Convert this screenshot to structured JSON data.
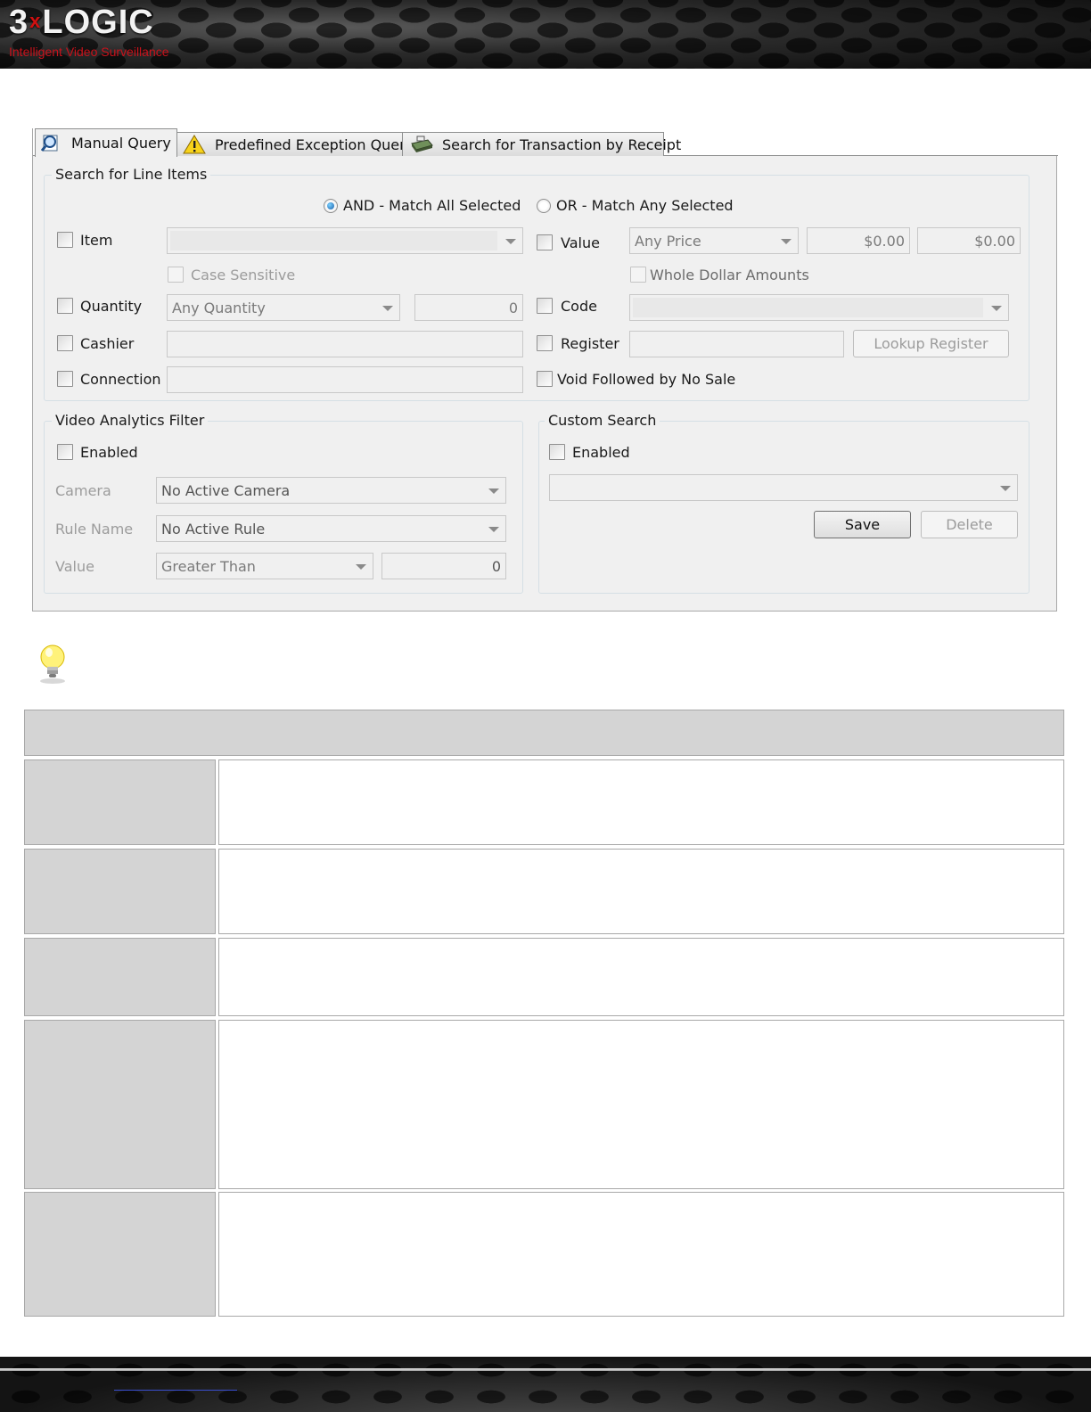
{
  "header": {
    "logo_left": "3",
    "logo_x": "x",
    "logo_right": "LOGIC",
    "tagline": "Intelligent Video Surveillance"
  },
  "tabs": [
    {
      "label": "Manual Query",
      "icon": "search-document-icon",
      "active": true
    },
    {
      "label": "Predefined Exception Query",
      "icon": "warning-icon",
      "active": false
    },
    {
      "label": "Search for Transaction by Receipt",
      "icon": "cash-register-icon",
      "active": false
    }
  ],
  "line_items": {
    "group_label": "Search for Line Items",
    "match_all_label": "AND - Match All Selected",
    "match_any_label": "OR - Match Any Selected",
    "selected_match": "AND",
    "item_label": "Item",
    "item_value": "",
    "case_sensitive_label": "Case Sensitive",
    "quantity_label": "Quantity",
    "quantity_mode": "Any Quantity",
    "quantity_value": "0",
    "cashier_label": "Cashier",
    "cashier_value": "",
    "connection_label": "Connection",
    "connection_value": "",
    "value_label": "Value",
    "price_mode": "Any Price",
    "price_min": "$0.00",
    "price_max": "$0.00",
    "whole_dollar_label": "Whole Dollar Amounts",
    "code_label": "Code",
    "code_value": "",
    "register_label": "Register",
    "register_value": "",
    "lookup_register_label": "Lookup Register",
    "void_label": "Void Followed by No Sale"
  },
  "video_analytics": {
    "group_label": "Video Analytics Filter",
    "enabled_label": "Enabled",
    "camera_label": "Camera",
    "camera_value": "No Active Camera",
    "rule_label": "Rule Name",
    "rule_value": "No Active Rule",
    "value_label": "Value",
    "comparison_value": "Greater Than",
    "threshold_value": "0"
  },
  "custom_search": {
    "group_label": "Custom Search",
    "enabled_label": "Enabled",
    "selected_search": "",
    "save_label": "Save",
    "delete_label": "Delete"
  },
  "colors": {
    "dialog_bg": "#f0f0f0",
    "table_header_bg": "#d4d4d4",
    "tagline_red": "#c8121b"
  }
}
